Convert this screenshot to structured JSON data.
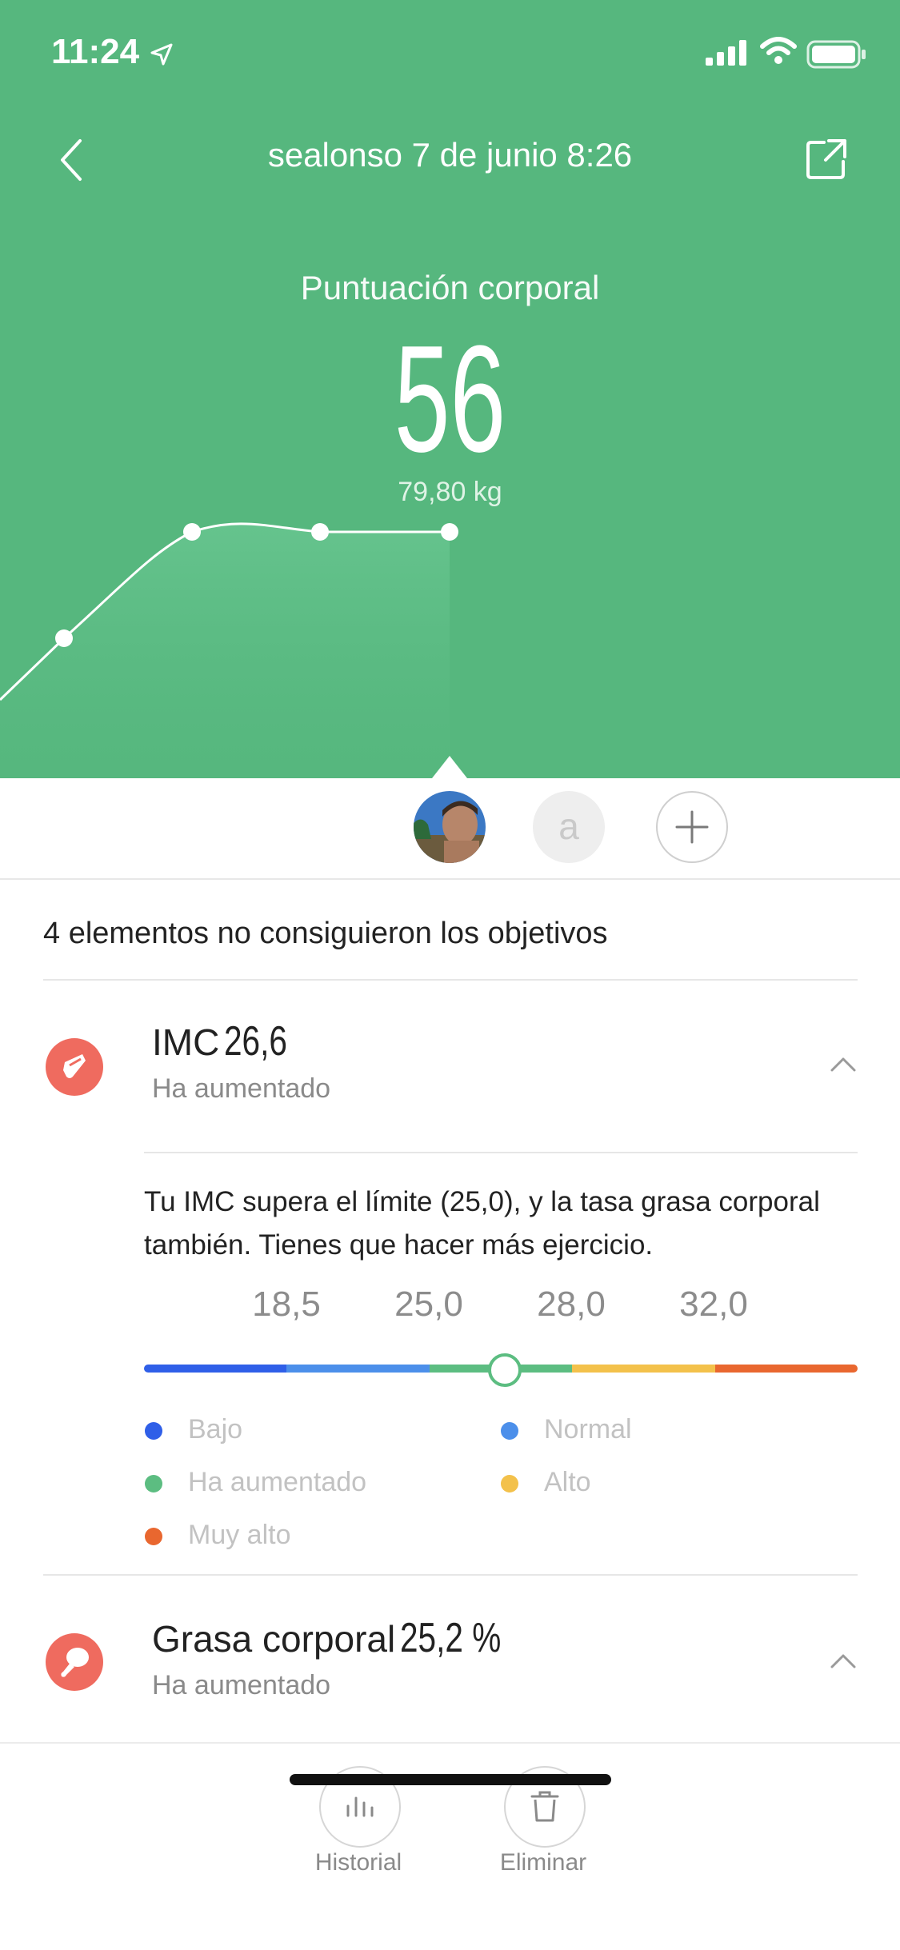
{
  "status_bar": {
    "time": "11:24"
  },
  "nav": {
    "title": "sealonso 7 de junio 8:26"
  },
  "score": {
    "label": "Puntuación corporal",
    "value": "56",
    "weight": "79,80 kg"
  },
  "colors": {
    "header_bg": "#56b77e",
    "accent_red": "#ef6b5f",
    "line": "#ffffff"
  },
  "profiles": [
    {
      "type": "photo",
      "name": "sealonso"
    },
    {
      "type": "letter",
      "letter": "a"
    },
    {
      "type": "add",
      "icon": "plus-icon"
    }
  ],
  "summary": "4 elementos no consiguieron los objetivos",
  "metrics": [
    {
      "name": "IMC",
      "value": "26,6",
      "status": "Ha aumentado",
      "icon": "bmi-drink-icon",
      "expanded": true
    },
    {
      "name": "Grasa corporal",
      "value": "25,2 %",
      "status": "Ha aumentado",
      "icon": "drumstick-icon",
      "expanded": true
    }
  ],
  "bmi_detail": {
    "description": "Tu IMC supera el límite (25,0), y la tasa grasa corporal también. Tienes que hacer más ejercicio.",
    "ticks": [
      "18,5",
      "25,0",
      "28,0",
      "32,0"
    ],
    "current_value": 26.6,
    "segments": [
      "#2f5fe8",
      "#4c8fea",
      "#5cbd81",
      "#f3c14b",
      "#e9672f"
    ],
    "legend": [
      {
        "label": "Bajo",
        "color": "#2f5fe8"
      },
      {
        "label": "Normal",
        "color": "#4c8fea"
      },
      {
        "label": "Ha aumentado",
        "color": "#5cbd81"
      },
      {
        "label": "Alto",
        "color": "#f3c14b"
      },
      {
        "label": "Muy alto",
        "color": "#e9672f"
      }
    ]
  },
  "bottom": {
    "history_label": "Historial",
    "delete_label": "Eliminar"
  }
}
